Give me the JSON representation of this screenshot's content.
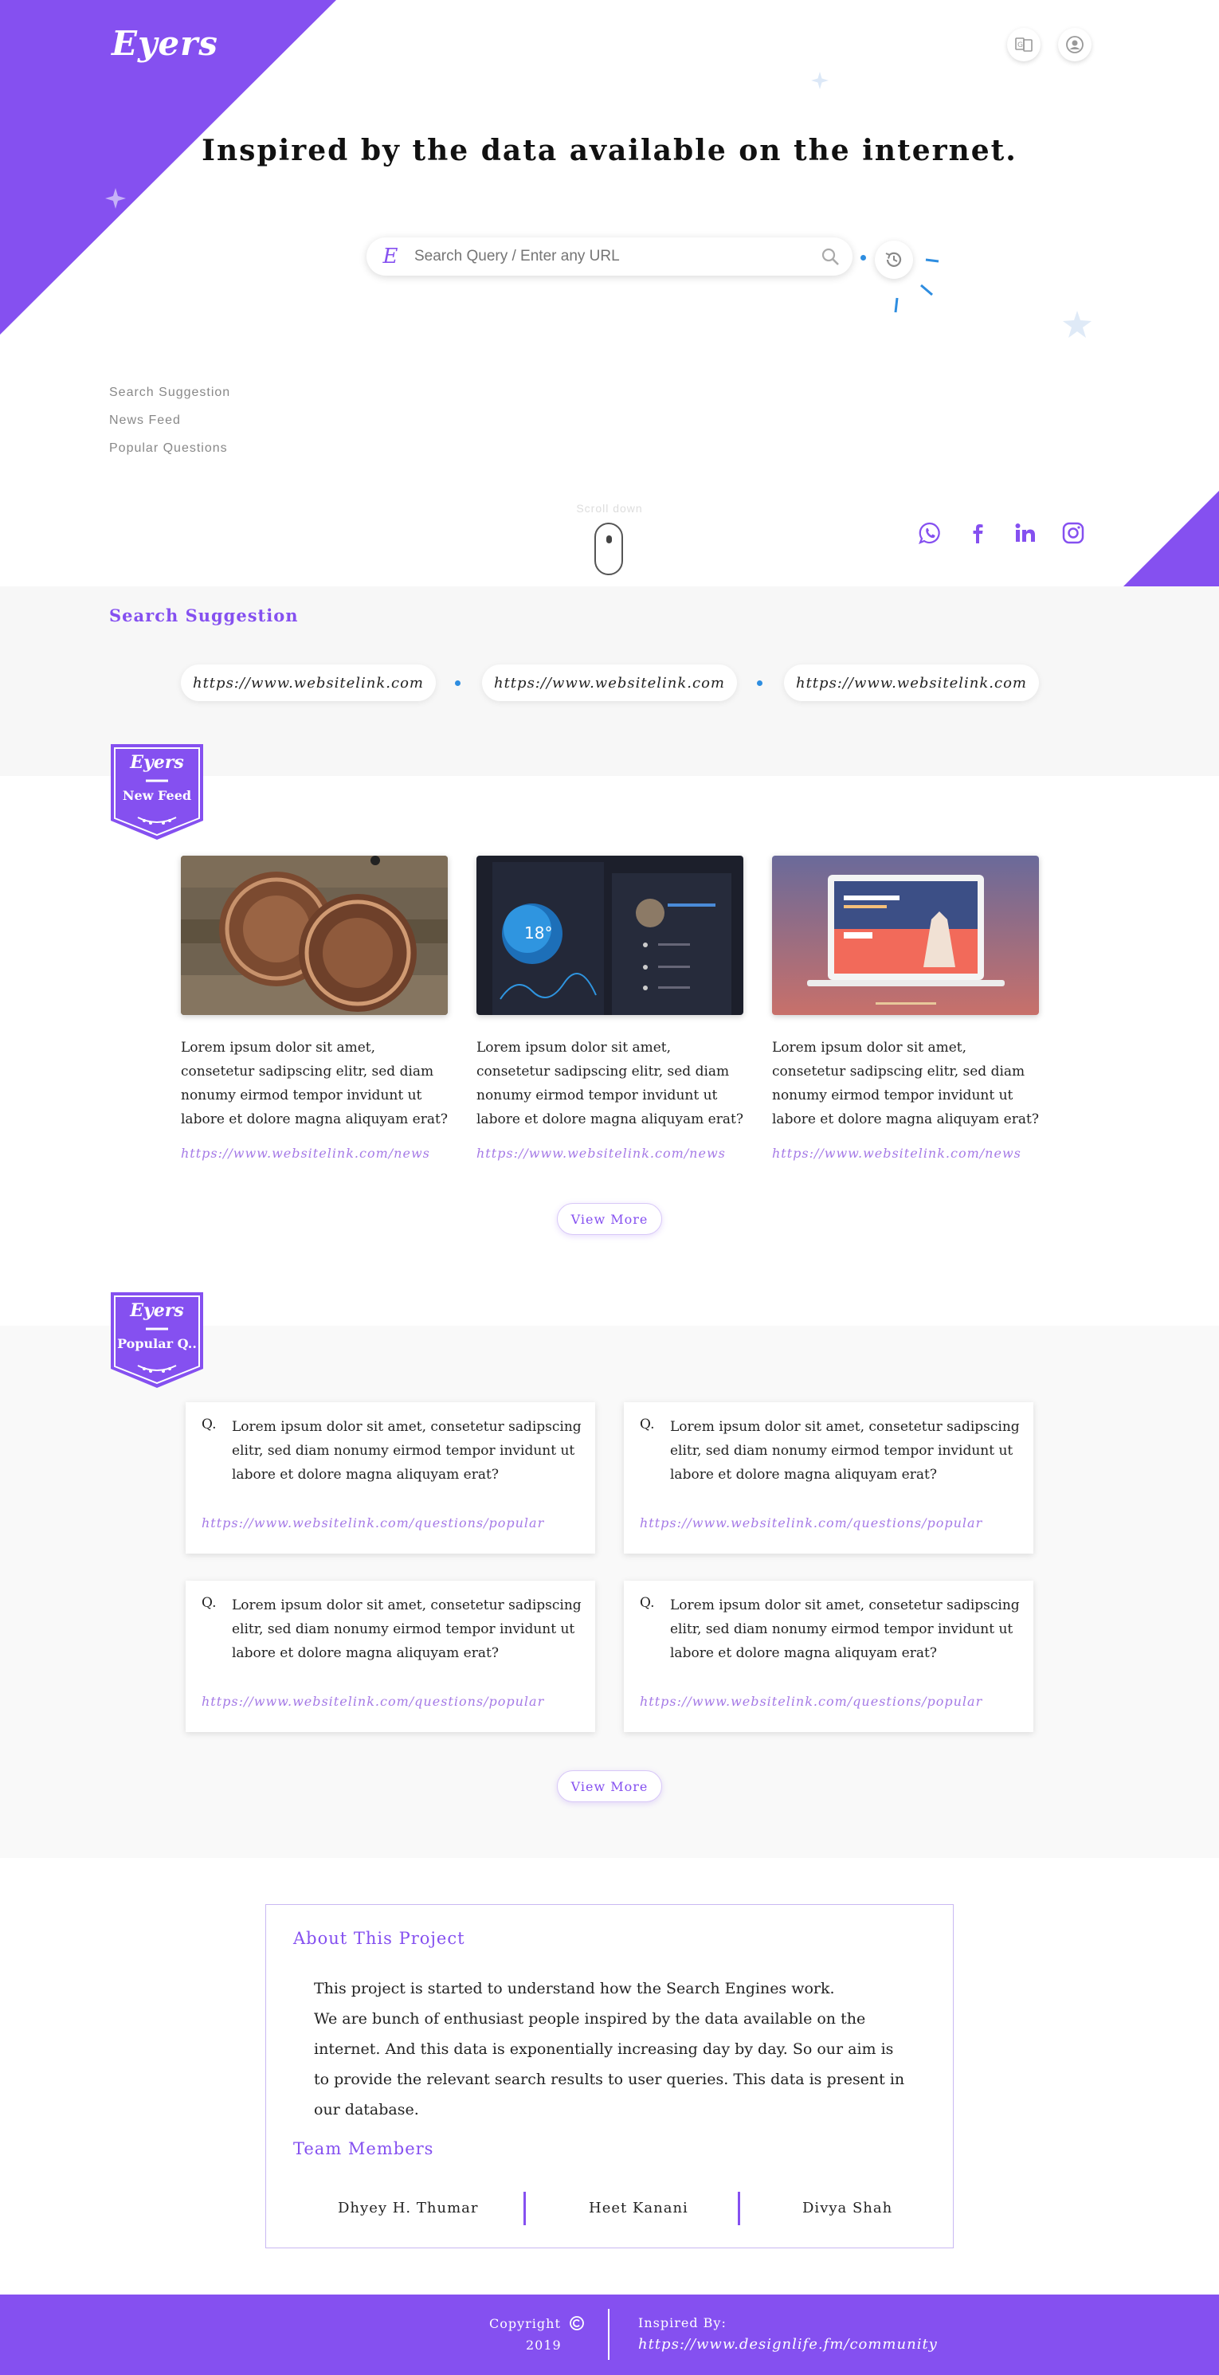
{
  "app": {
    "logo": "Eyers"
  },
  "header": {
    "translate_icon": "translate-icon",
    "account_icon": "account-icon"
  },
  "hero": {
    "headline": "Inspired by the data available on the internet.",
    "search": {
      "prefix": "E",
      "placeholder": "Search Query / Enter any URL",
      "icon": "search-icon"
    },
    "history_icon": "history-icon",
    "scroll_label": "Scroll down"
  },
  "side_nav": [
    "Search Suggestion",
    "News Feed",
    "Popular Questions"
  ],
  "socials": [
    "whatsapp-icon",
    "facebook-icon",
    "linkedin-icon",
    "instagram-icon"
  ],
  "suggestions": {
    "title": "Search Suggestion",
    "items": [
      "https://www.websitelink.com",
      "https://www.websitelink.com",
      "https://www.websitelink.com"
    ]
  },
  "news": {
    "badge_logo": "Eyers",
    "badge_label": "New Feed",
    "items": [
      {
        "text": "Lorem ipsum dolor sit amet, consetetur sadipscing elitr, sed diam nonumy eirmod tempor invidunt ut labore et dolore magna aliquyam erat?",
        "link": "https://www.websitelink.com/news"
      },
      {
        "text": "Lorem ipsum dolor sit amet, consetetur sadipscing elitr, sed diam nonumy eirmod tempor invidunt ut labore et dolore magna aliquyam erat?",
        "link": "https://www.websitelink.com/news"
      },
      {
        "text": "Lorem ipsum dolor sit amet, consetetur sadipscing elitr, sed diam nonumy eirmod tempor invidunt ut labore et dolore magna aliquyam erat?",
        "link": "https://www.websitelink.com/news"
      }
    ],
    "view_more": "View More"
  },
  "popular": {
    "badge_logo": "Eyers",
    "badge_label": "Popular Q..",
    "items": [
      {
        "q": "Q.",
        "text": "Lorem ipsum dolor sit amet, consetetur sadipscing elitr, sed diam nonumy eirmod tempor invidunt ut labore et dolore magna aliquyam erat?",
        "link": "https://www.websitelink.com/questions/popular"
      },
      {
        "q": "Q.",
        "text": "Lorem ipsum dolor sit amet, consetetur sadipscing elitr, sed diam nonumy eirmod tempor invidunt ut labore et dolore magna aliquyam erat?",
        "link": "https://www.websitelink.com/questions/popular"
      },
      {
        "q": "Q.",
        "text": "Lorem ipsum dolor sit amet, consetetur sadipscing elitr, sed diam nonumy eirmod tempor invidunt ut labore et dolore magna aliquyam erat?",
        "link": "https://www.websitelink.com/questions/popular"
      },
      {
        "q": "Q.",
        "text": "Lorem ipsum dolor sit amet, consetetur sadipscing elitr, sed diam nonumy eirmod tempor invidunt ut labore et dolore magna aliquyam erat?",
        "link": "https://www.websitelink.com/questions/popular"
      }
    ],
    "view_more": "View More"
  },
  "about": {
    "title": "About This Project",
    "lines": [
      "This project is started to understand how the Search Engines work.",
      "We are bunch of enthusiast people inspired by the data available on the",
      "internet. And this data is exponentially increasing day by day. So our aim is",
      "to provide the relevant search results to user queries. This data is present in",
      "our database."
    ],
    "team_title": "Team Members",
    "members": [
      "Dhyey H. Thumar",
      "Heet Kanani",
      "Divya Shah"
    ]
  },
  "footer": {
    "copyright": "Copyright",
    "copyright_icon": "copyright-icon",
    "year": "2019",
    "inspired_label": "Inspired By:",
    "inspired_link": "https://www.designlife.fm/community"
  },
  "colors": {
    "accent": "#8550f0",
    "link": "#a57ae6",
    "dot": "#2e8de0"
  }
}
